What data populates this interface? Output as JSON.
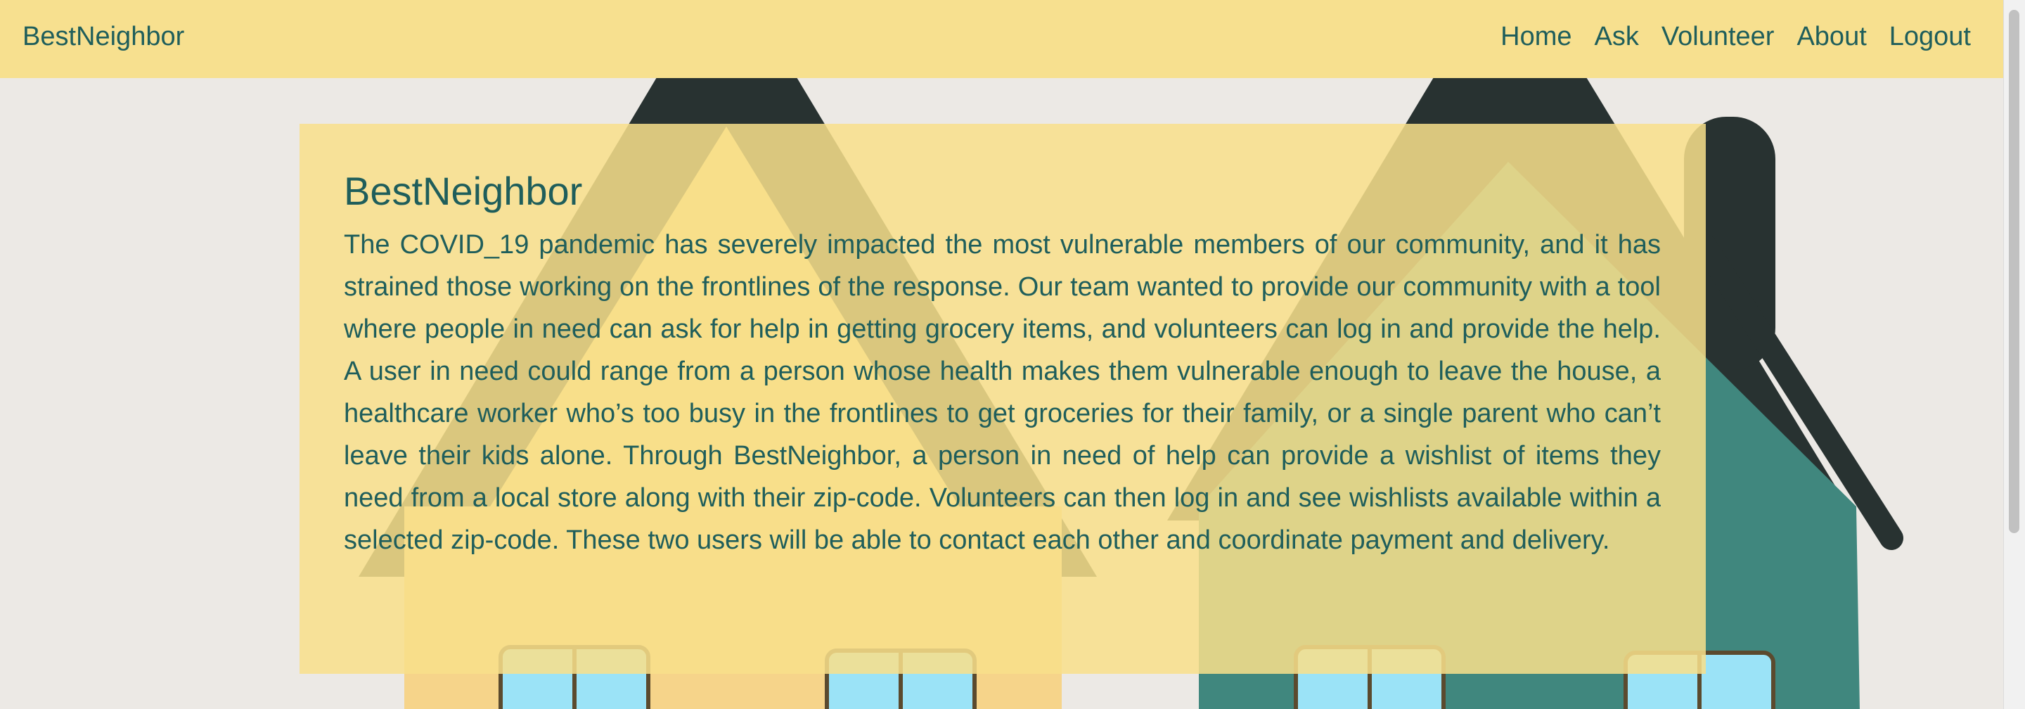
{
  "navbar": {
    "brand": "BestNeighbor",
    "links": [
      "Home",
      "Ask",
      "Volunteer",
      "About",
      "Logout"
    ]
  },
  "hero": {
    "title": "BestNeighbor",
    "description": "The COVID_19 pandemic has severely impacted the most vulnerable members of our community, and it has strained those working on the frontlines of the response. Our team wanted to provide our community with a tool where people in need can ask for help in getting grocery items, and volunteers can log in and provide the help. A user in need could range from a person whose health makes them vulnerable enough to leave the house, a healthcare worker who’s too busy in the frontlines to get groceries for their family, or a single parent who can’t leave their kids alone. Through BestNeighbor, a person in need of help can provide a wishlist of items they need from a local store along with their zip-code. Volunteers can then log in and see wishlists available within a selected zip-code. These two users will be able to contact each other and coordinate payment and delivery."
  },
  "colors": {
    "navbar_bg": "#f7e08f",
    "text": "#1f5e5b",
    "page_bg": "#ece9e5",
    "house_teal": "#40877e",
    "roof_dark": "#283231",
    "window_blue": "#9be3f7"
  }
}
